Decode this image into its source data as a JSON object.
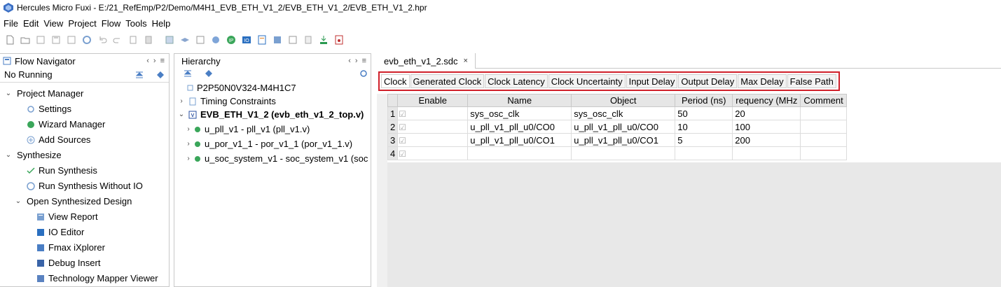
{
  "window": {
    "title": "Hercules Micro Fuxi - E:/21_RefEmp/P2/Demo/M4H1_EVB_ETH_V1_2/EVB_ETH_V1_2/EVB_ETH_V1_2.hpr"
  },
  "menu": [
    "File",
    "Edit",
    "View",
    "Project",
    "Flow",
    "Tools",
    "Help"
  ],
  "flow_navigator": {
    "title": "Flow Navigator",
    "status": "No Running",
    "items": [
      {
        "label": "Project Manager",
        "icon": "chevron-down",
        "level": 0
      },
      {
        "label": "Settings",
        "icon": "gear-icon",
        "level": 1
      },
      {
        "label": "Wizard Manager",
        "icon": "ip-icon",
        "level": 1
      },
      {
        "label": "Add Sources",
        "icon": "plus-circle-icon",
        "level": 1
      },
      {
        "label": "Synthesize",
        "icon": "chevron-down",
        "level": 0
      },
      {
        "label": "Run Synthesis",
        "icon": "check-icon",
        "level": 1
      },
      {
        "label": "Run Synthesis Without IO",
        "icon": "run-io-icon",
        "level": 1
      },
      {
        "label": "Open Synthesized Design",
        "icon": "chevron-down",
        "level": 0
      },
      {
        "label": "View Report",
        "icon": "report-icon",
        "level": 2
      },
      {
        "label": "IO Editor",
        "icon": "io-icon",
        "level": 2
      },
      {
        "label": "Fmax iXplorer",
        "icon": "fmax-icon",
        "level": 2
      },
      {
        "label": "Debug Insert",
        "icon": "debug-icon",
        "level": 2
      },
      {
        "label": "Technology Mapper Viewer",
        "icon": "mapper-icon",
        "level": 2
      }
    ]
  },
  "hierarchy": {
    "title": "Hierarchy",
    "items": [
      {
        "label": "P2P50N0V324-M4H1C7"
      },
      {
        "label": "Timing Constraints"
      },
      {
        "label": "EVB_ETH_V1_2 (evb_eth_v1_2_top.v)"
      },
      {
        "label": "u_pll_v1 - pll_v1 (pll_v1.v)"
      },
      {
        "label": "u_por_v1_1 - por_v1_1 (por_v1_1.v)"
      },
      {
        "label": "u_soc_system_v1 - soc_system_v1 (soc"
      }
    ]
  },
  "editor": {
    "file_tab": "evb_eth_v1_2.sdc",
    "constraint_tabs": [
      "Clock",
      "Generated Clock",
      "Clock Latency",
      "Clock Uncertainty",
      "Input Delay",
      "Output Delay",
      "Max Delay",
      "False Path"
    ],
    "columns": [
      "Enable",
      "Name",
      "Object",
      "Period (ns)",
      "requency (MHz",
      "Comment"
    ],
    "rows": [
      {
        "num": "1",
        "name": "sys_osc_clk",
        "object": "sys_osc_clk",
        "period": "50",
        "freq": "20",
        "comment": ""
      },
      {
        "num": "2",
        "name": "u_pll_v1_pll_u0/CO0",
        "object": "u_pll_v1_pll_u0/CO0",
        "period": "10",
        "freq": "100",
        "comment": ""
      },
      {
        "num": "3",
        "name": "u_pll_v1_pll_u0/CO1",
        "object": "u_pll_v1_pll_u0/CO1",
        "period": "5",
        "freq": "200",
        "comment": ""
      },
      {
        "num": "4",
        "name": "",
        "object": "",
        "period": "",
        "freq": "",
        "comment": ""
      }
    ]
  }
}
